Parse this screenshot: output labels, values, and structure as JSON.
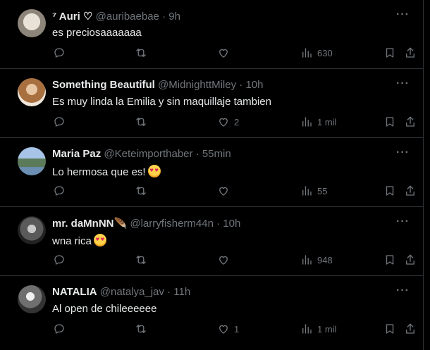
{
  "tweets": [
    {
      "name": "⁷ Auri ♡",
      "handle": "@auribaebae",
      "time": "9h",
      "text": "es preciosaaaaaaa",
      "emoji": false,
      "replies": "",
      "retweets": "",
      "likes": "",
      "views": "630"
    },
    {
      "name": "Something Beautiful",
      "handle": "@MidnighttMiley",
      "time": "10h",
      "text": "Es muy linda la Emilia y sin maquillaje tambien",
      "emoji": false,
      "replies": "",
      "retweets": "",
      "likes": "2",
      "views": "1 mil"
    },
    {
      "name": "Maria Paz",
      "handle": "@Keteimporthaber",
      "time": "55min",
      "text": "Lo hermosa que es!",
      "emoji": true,
      "replies": "",
      "retweets": "",
      "likes": "",
      "views": "55"
    },
    {
      "name": "mr. daMnNN🪶",
      "handle": "@larryfisherm44n",
      "time": "10h",
      "text": "wna rica",
      "emoji": true,
      "replies": "",
      "retweets": "",
      "likes": "",
      "views": "948"
    },
    {
      "name": "NATALIA",
      "handle": "@natalya_jav",
      "time": "11h",
      "text": "Al open de chileeeeee",
      "emoji": false,
      "replies": "",
      "retweets": "",
      "likes": "1",
      "views": "1 mil"
    }
  ],
  "icons": {
    "reply": "reply-icon",
    "retweet": "retweet-icon",
    "like": "heart-icon",
    "views": "views-icon",
    "bookmark": "bookmark-icon",
    "share": "share-icon",
    "more": "more-icon"
  },
  "colors": {
    "background": "#000000",
    "text": "#e7e9ea",
    "muted": "#71767b",
    "border": "#2f3336"
  }
}
